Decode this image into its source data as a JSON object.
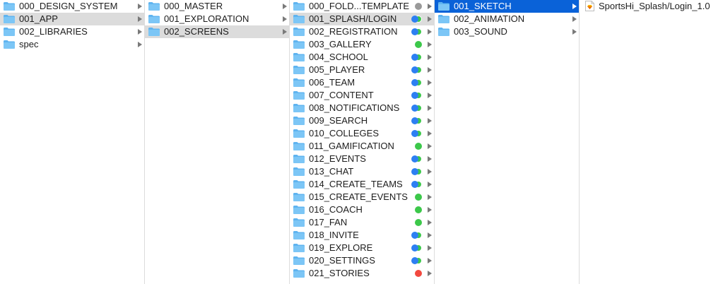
{
  "colors": {
    "selection_blue": "#0a62d8",
    "selection_gray": "#dcdcdc",
    "folder": "#5fb4f0",
    "tag_blue": "#2d7ff2",
    "tag_green": "#3cc84a",
    "tag_gray": "#9a9a9a",
    "tag_red": "#f2493f"
  },
  "col1": {
    "items": [
      {
        "label": "000_DESIGN_SYSTEM",
        "icon": "folder-icon"
      },
      {
        "label": "001_APP",
        "icon": "folder-icon"
      },
      {
        "label": "002_LIBRARIES",
        "icon": "folder-icon"
      },
      {
        "label": "spec",
        "icon": "folder-icon"
      }
    ]
  },
  "col2": {
    "items": [
      {
        "label": "000_MASTER",
        "icon": "folder-icon"
      },
      {
        "label": "001_EXPLORATION",
        "icon": "folder-icon"
      },
      {
        "label": "002_SCREENS",
        "icon": "folder-icon"
      }
    ]
  },
  "col3": {
    "items": [
      {
        "label": "000_FOLD...TEMPLATE",
        "tags": [
          "gray"
        ]
      },
      {
        "label": "001_SPLASH/LOGIN",
        "tags": [
          "blue",
          "green"
        ]
      },
      {
        "label": "002_REGISTRATION",
        "tags": [
          "blue",
          "green"
        ]
      },
      {
        "label": "003_GALLERY",
        "tags": [
          "green"
        ]
      },
      {
        "label": "004_SCHOOL",
        "tags": [
          "blue",
          "green"
        ]
      },
      {
        "label": "005_PLAYER",
        "tags": [
          "blue",
          "green"
        ]
      },
      {
        "label": "006_TEAM",
        "tags": [
          "blue",
          "green"
        ]
      },
      {
        "label": "007_CONTENT",
        "tags": [
          "blue",
          "green"
        ]
      },
      {
        "label": "008_NOTIFICATIONS",
        "tags": [
          "blue",
          "green"
        ]
      },
      {
        "label": "009_SEARCH",
        "tags": [
          "blue",
          "green"
        ]
      },
      {
        "label": "010_COLLEGES",
        "tags": [
          "blue",
          "green"
        ]
      },
      {
        "label": "011_GAMIFICATION",
        "tags": [
          "green"
        ]
      },
      {
        "label": "012_EVENTS",
        "tags": [
          "blue",
          "green"
        ]
      },
      {
        "label": "013_CHAT",
        "tags": [
          "blue",
          "green"
        ]
      },
      {
        "label": "014_CREATE_TEAMS",
        "tags": [
          "blue",
          "green"
        ]
      },
      {
        "label": "015_CREATE_EVENTS",
        "tags": [
          "green"
        ]
      },
      {
        "label": "016_COACH",
        "tags": [
          "green"
        ]
      },
      {
        "label": "017_FAN",
        "tags": [
          "green"
        ]
      },
      {
        "label": "018_INVITE",
        "tags": [
          "blue",
          "green"
        ]
      },
      {
        "label": "019_EXPLORE",
        "tags": [
          "blue",
          "green"
        ]
      },
      {
        "label": "020_SETTINGS",
        "tags": [
          "blue",
          "green"
        ]
      },
      {
        "label": "021_STORIES",
        "tags": [
          "red"
        ]
      }
    ]
  },
  "col4": {
    "items": [
      {
        "label": "001_SKETCH",
        "icon": "folder-icon"
      },
      {
        "label": "002_ANIMATION",
        "icon": "folder-icon"
      },
      {
        "label": "003_SOUND",
        "icon": "folder-icon"
      }
    ]
  },
  "col5": {
    "items": [
      {
        "label": "SportsHi_Splash/Login_1.0",
        "icon": "sketch-file-icon"
      }
    ]
  }
}
